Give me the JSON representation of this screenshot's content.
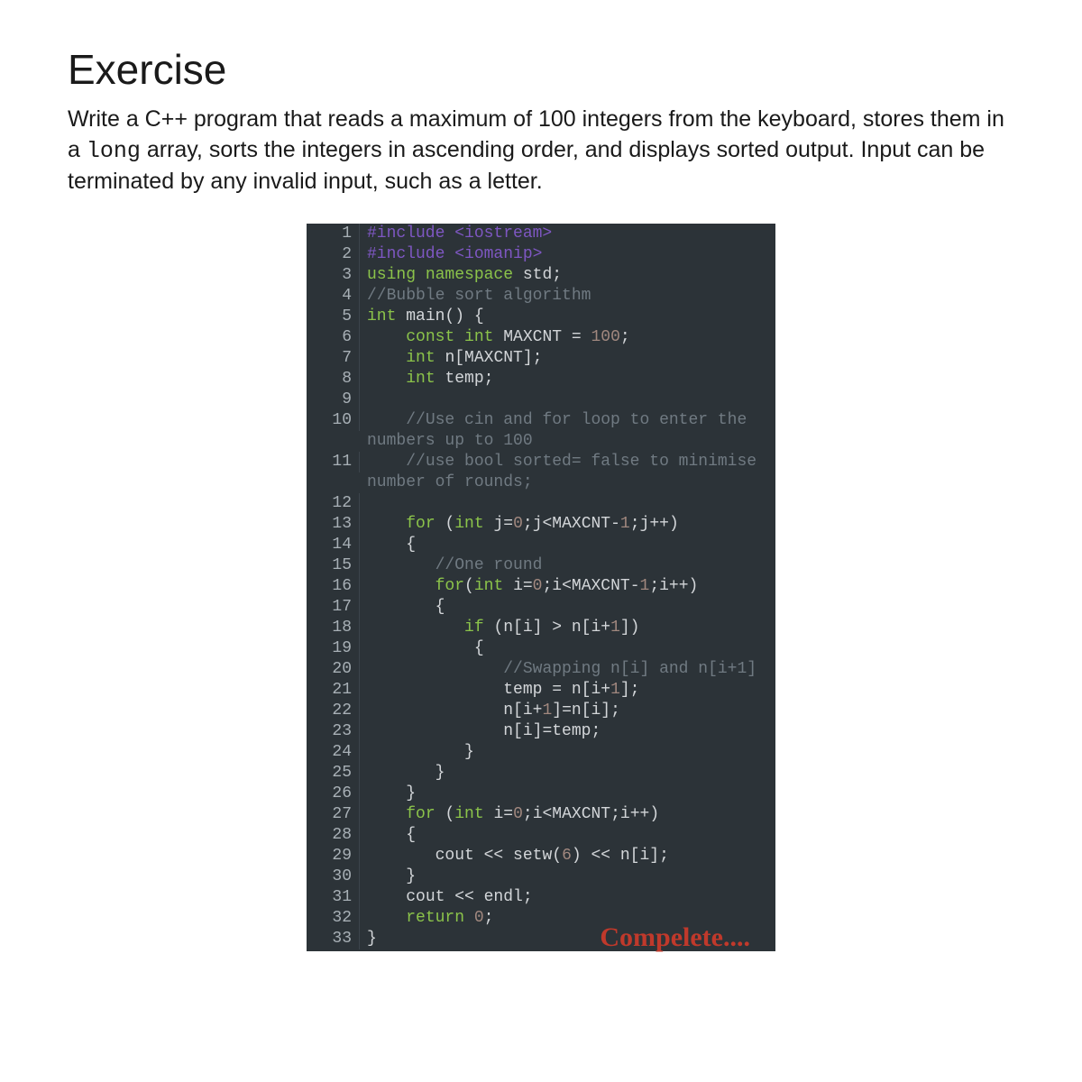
{
  "title": "Exercise",
  "prompt_pre": "Write a C++ program that reads a maximum of 100 integers from the keyboard, stores them in a ",
  "prompt_mono": "long",
  "prompt_post": "  array, sorts the integers in ascending order, and displays sorted output. Input can be terminated by any invalid input, such as a letter.",
  "watermark": "Compelete....",
  "code_lines": [
    {
      "n": 1,
      "segs": [
        [
          "pre",
          "#include "
        ],
        [
          "pre",
          "<iostream>"
        ]
      ]
    },
    {
      "n": 2,
      "segs": [
        [
          "pre",
          "#include "
        ],
        [
          "pre",
          "<iomanip>"
        ]
      ]
    },
    {
      "n": 3,
      "segs": [
        [
          "kw",
          "using "
        ],
        [
          "kw",
          "namespace "
        ],
        [
          "txt",
          "std;"
        ]
      ]
    },
    {
      "n": 4,
      "segs": [
        [
          "cmt",
          "//Bubble sort algorithm"
        ]
      ]
    },
    {
      "n": 5,
      "segs": [
        [
          "kw",
          "int "
        ],
        [
          "txt",
          "main() {"
        ]
      ]
    },
    {
      "n": 6,
      "segs": [
        [
          "txt",
          "    "
        ],
        [
          "kw",
          "const int "
        ],
        [
          "txt",
          "MAXCNT = "
        ],
        [
          "num",
          "100"
        ],
        [
          "txt",
          ";"
        ]
      ]
    },
    {
      "n": 7,
      "segs": [
        [
          "txt",
          "    "
        ],
        [
          "kw",
          "int "
        ],
        [
          "txt",
          "n[MAXCNT];"
        ]
      ]
    },
    {
      "n": 8,
      "segs": [
        [
          "txt",
          "    "
        ],
        [
          "kw",
          "int "
        ],
        [
          "txt",
          "temp;"
        ]
      ]
    },
    {
      "n": 9,
      "segs": [
        [
          "txt",
          " "
        ]
      ]
    },
    {
      "n": 10,
      "segs": [
        [
          "txt",
          "    "
        ],
        [
          "cmt",
          "//Use cin and for loop to enter the numbers up to 100"
        ]
      ]
    },
    {
      "n": 11,
      "segs": [
        [
          "txt",
          "    "
        ],
        [
          "cmt",
          "//use bool sorted= false to minimise number of rounds;"
        ]
      ]
    },
    {
      "n": 12,
      "segs": [
        [
          "txt",
          " "
        ]
      ]
    },
    {
      "n": 13,
      "segs": [
        [
          "txt",
          "    "
        ],
        [
          "kw",
          "for "
        ],
        [
          "txt",
          "("
        ],
        [
          "kw",
          "int "
        ],
        [
          "txt",
          "j="
        ],
        [
          "num",
          "0"
        ],
        [
          "txt",
          ";j<MAXCNT-"
        ],
        [
          "num",
          "1"
        ],
        [
          "txt",
          ";j++)"
        ]
      ]
    },
    {
      "n": 14,
      "segs": [
        [
          "txt",
          "    {"
        ]
      ]
    },
    {
      "n": 15,
      "segs": [
        [
          "txt",
          "       "
        ],
        [
          "cmt",
          "//One round"
        ]
      ]
    },
    {
      "n": 16,
      "segs": [
        [
          "txt",
          "       "
        ],
        [
          "kw",
          "for"
        ],
        [
          "txt",
          "("
        ],
        [
          "kw",
          "int "
        ],
        [
          "txt",
          "i="
        ],
        [
          "num",
          "0"
        ],
        [
          "txt",
          ";i<MAXCNT-"
        ],
        [
          "num",
          "1"
        ],
        [
          "txt",
          ";i++)"
        ]
      ]
    },
    {
      "n": 17,
      "segs": [
        [
          "txt",
          "       {"
        ]
      ]
    },
    {
      "n": 18,
      "segs": [
        [
          "txt",
          "          "
        ],
        [
          "kw",
          "if "
        ],
        [
          "txt",
          "(n[i] > n[i+"
        ],
        [
          "num",
          "1"
        ],
        [
          "txt",
          "])"
        ]
      ]
    },
    {
      "n": 19,
      "segs": [
        [
          "txt",
          "           {"
        ]
      ]
    },
    {
      "n": 20,
      "segs": [
        [
          "txt",
          "              "
        ],
        [
          "cmt",
          "//Swapping n[i] and n[i+1]"
        ]
      ]
    },
    {
      "n": 21,
      "segs": [
        [
          "txt",
          "              temp = n[i+"
        ],
        [
          "num",
          "1"
        ],
        [
          "txt",
          "];"
        ]
      ]
    },
    {
      "n": 22,
      "segs": [
        [
          "txt",
          "              n[i+"
        ],
        [
          "num",
          "1"
        ],
        [
          "txt",
          "]=n[i];"
        ]
      ]
    },
    {
      "n": 23,
      "segs": [
        [
          "txt",
          "              n[i]=temp;"
        ]
      ]
    },
    {
      "n": 24,
      "segs": [
        [
          "txt",
          "          }"
        ]
      ]
    },
    {
      "n": 25,
      "segs": [
        [
          "txt",
          "       }"
        ]
      ]
    },
    {
      "n": 26,
      "segs": [
        [
          "txt",
          "    }"
        ]
      ]
    },
    {
      "n": 27,
      "segs": [
        [
          "txt",
          "    "
        ],
        [
          "kw",
          "for "
        ],
        [
          "txt",
          "("
        ],
        [
          "kw",
          "int "
        ],
        [
          "txt",
          "i="
        ],
        [
          "num",
          "0"
        ],
        [
          "txt",
          ";i<MAXCNT;i++)"
        ]
      ]
    },
    {
      "n": 28,
      "segs": [
        [
          "txt",
          "    {"
        ]
      ]
    },
    {
      "n": 29,
      "segs": [
        [
          "txt",
          "       cout << setw("
        ],
        [
          "num",
          "6"
        ],
        [
          "txt",
          ") << n[i];"
        ]
      ]
    },
    {
      "n": 30,
      "segs": [
        [
          "txt",
          "    }"
        ]
      ]
    },
    {
      "n": 31,
      "segs": [
        [
          "txt",
          "    cout << endl;"
        ]
      ]
    },
    {
      "n": 32,
      "segs": [
        [
          "txt",
          "    "
        ],
        [
          "kw",
          "return "
        ],
        [
          "num",
          "0"
        ],
        [
          "txt",
          ";"
        ]
      ]
    },
    {
      "n": 33,
      "segs": [
        [
          "txt",
          "}"
        ]
      ]
    }
  ]
}
